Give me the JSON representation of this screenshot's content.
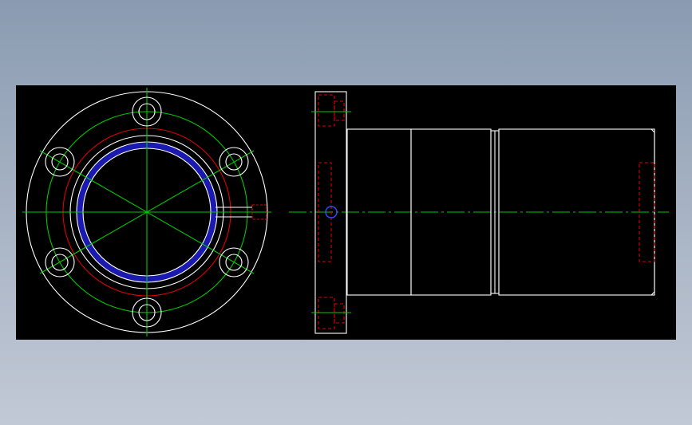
{
  "drawing": {
    "description_visible_text": "",
    "colors": {
      "background": "#000000",
      "outline": "#ffffff",
      "centerline": "#00c800",
      "hidden": "#e00000",
      "seal": "#1010a0",
      "hole": "#3050ff"
    },
    "views": [
      {
        "name": "front-view"
      },
      {
        "name": "side-view"
      }
    ]
  }
}
